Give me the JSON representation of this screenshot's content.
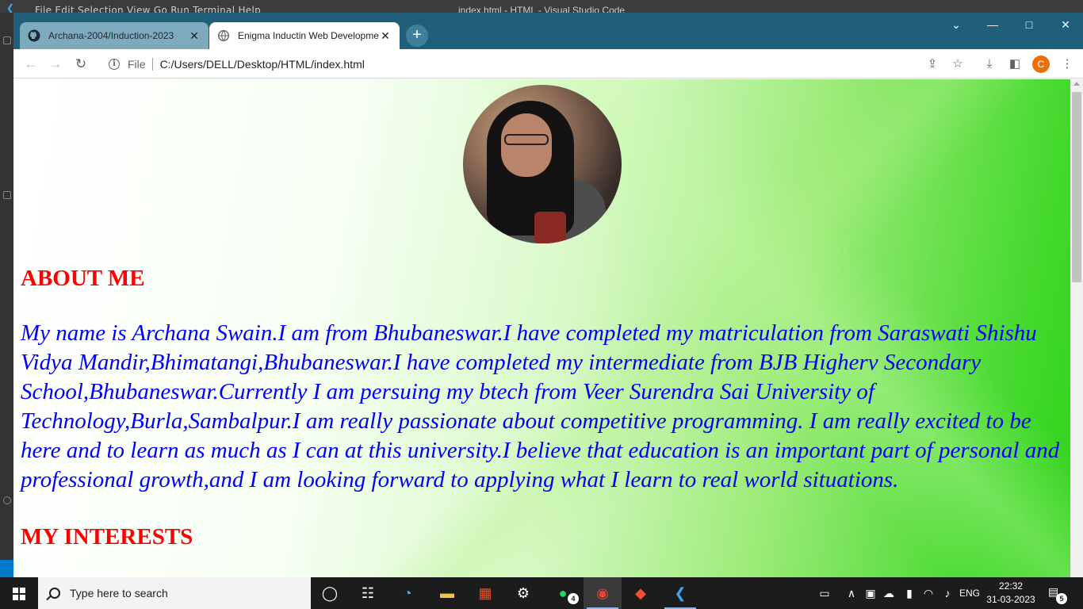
{
  "vscode": {
    "menu": "File   Edit   Selection   View   Go   Run   Terminal   Help",
    "title": "index.html - HTML - Visual Studio Code"
  },
  "browser": {
    "tabs": [
      {
        "label": "Archana-2004/Induction-2023",
        "icon": "github-icon",
        "active": false
      },
      {
        "label": "Enigma Inductin Web Developme",
        "icon": "globe-icon",
        "active": true
      }
    ],
    "address": {
      "scheme": "File",
      "url": "C:/Users/DELL/Desktop/HTML/index.html"
    },
    "profile_initial": "C",
    "colors": {
      "tabstrip": "#1f5f7a",
      "profile": "#e8710a"
    }
  },
  "page": {
    "about_heading": "ABOUT ME",
    "about_text": "My name is Archana Swain.I am from Bhubaneswar.I have completed my matriculation from Saraswati Shishu Vidya Mandir,Bhimatangi,Bhubaneswar.I have completed my intermediate from BJB Higherv Secondary School,Bhubaneswar.Currently I am persuing my btech from Veer Surendra Sai University of Technology,Burla,Sambalpur.I am really passionate about competitive programming. I am really excited to be here and to learn as much as I can at this university.I believe that education is an important part of personal and professional growth,and I am looking forward to applying what I learn to real world situations.",
    "interests_heading": "MY INTERESTS",
    "colors": {
      "heading": "#ff0000",
      "text": "#0000ff"
    }
  },
  "taskbar": {
    "search_placeholder": "Type here to search",
    "whatsapp_badge": "4",
    "language": "ENG",
    "time": "22:32",
    "date": "31-03-2023",
    "notification_count": "5"
  }
}
